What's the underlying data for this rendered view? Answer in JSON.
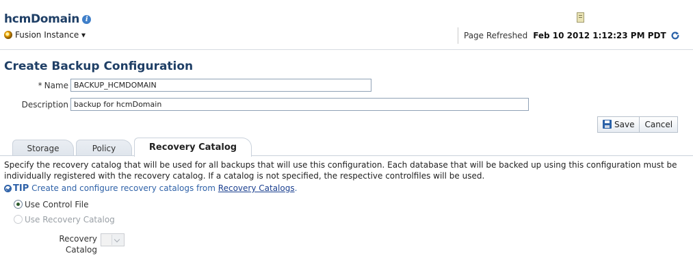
{
  "header": {
    "domain_title": "hcmDomain",
    "instance_menu": "Fusion Instance ▾",
    "refresh_label": "Page Refreshed",
    "refresh_time": "Feb 10 2012 1:12:23 PM PDT"
  },
  "page": {
    "title": "Create Backup Configuration"
  },
  "form": {
    "name_label": "Name",
    "name_required": "*",
    "name_value": "BACKUP_HCMDOMAIN",
    "description_label": "Description",
    "description_value": "backup for hcmDomain"
  },
  "buttons": {
    "save": "Save",
    "cancel": "Cancel"
  },
  "tabs": [
    {
      "label": "Storage",
      "active": false
    },
    {
      "label": "Policy",
      "active": false
    },
    {
      "label": "Recovery Catalog",
      "active": true
    }
  ],
  "recovery": {
    "description": "Specify the recovery catalog that will be used for all backups that will use this configuration. Each database that will be backed up using this configuration must be individually registered with the recovery catalog. If a catalog is not specified, the respective controlfiles will be used.",
    "tip_mark": "TIP",
    "tip_text": "Create and configure recovery catalogs from",
    "tip_link": "Recovery Catalogs",
    "tip_end": ".",
    "option_control_file": "Use Control File",
    "option_recovery_catalog": "Use Recovery Catalog",
    "catalog_label": "Recovery Catalog",
    "selected_option": "Use Control File"
  },
  "icons": {
    "info": "info-icon",
    "instance": "fusion-instance-icon",
    "server": "server-icon",
    "refresh": "refresh-icon",
    "save": "save-icon",
    "tip": "checkmark-icon"
  },
  "colors": {
    "title": "#1f3f66",
    "link": "#2f62a8"
  }
}
